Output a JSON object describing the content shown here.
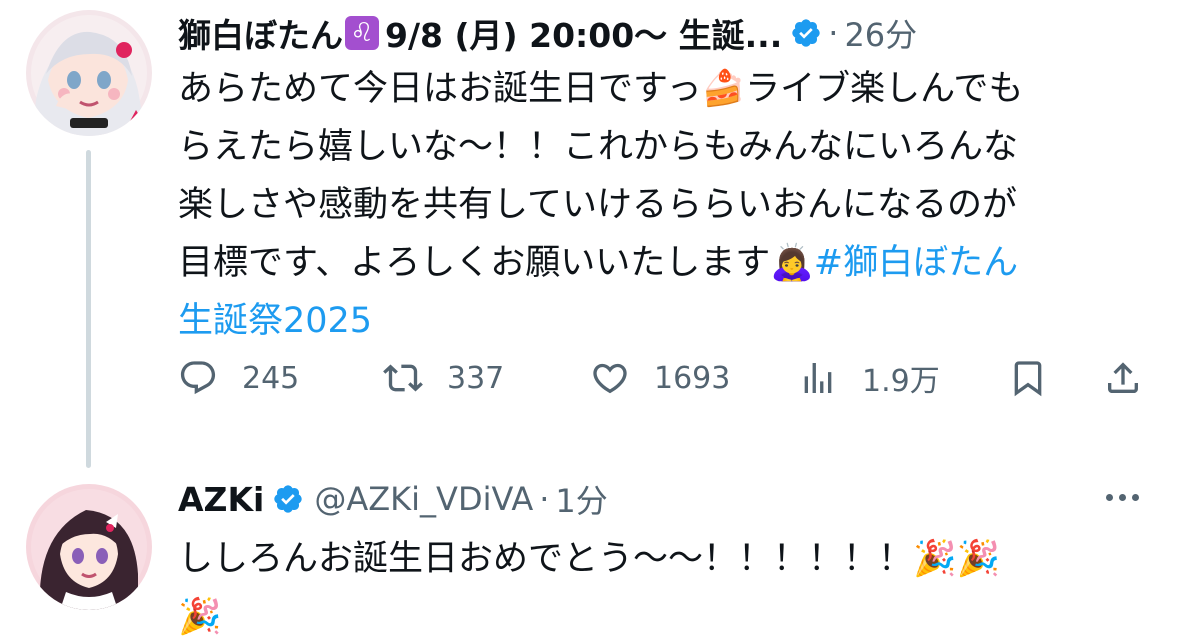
{
  "tweets": [
    {
      "display_name": "獅白ぼたん",
      "name_badge": "♌",
      "name_suffix": "9/8 (月) 20:00～ 生誕...",
      "time": "26分",
      "dot": "·",
      "body_lines": [
        "あらためて今日はお誕生日ですっ🍰ライブ楽しんでも",
        "らえたら嬉しいな～！！これからもみんなにいろんな",
        "楽しさや感動を共有していけるららいおんになるのが",
        "目標です、よろしくお願いいたします🙇‍♀️"
      ],
      "hashtag_part1": "#獅白ぼたん",
      "hashtag_part2": "生誕祭2025",
      "stats": {
        "replies": "245",
        "retweets": "337",
        "likes": "1693",
        "views": "1.9万"
      }
    },
    {
      "display_name": "AZKi",
      "handle": "@AZKi_VDiVA",
      "dot": "·",
      "time": "1分",
      "body_lines": [
        "ししろんお誕生日おめでとう～～！！！！！！🎉🎉",
        "🎉"
      ]
    }
  ],
  "colors": {
    "text": "#0f1419",
    "secondary": "#536471",
    "link": "#1d9bf0",
    "verified": "#1d9bf0",
    "thread_line": "#cfd9de",
    "leo_badge": "#a34fcf"
  },
  "icons": {
    "reply": "reply-icon",
    "retweet": "retweet-icon",
    "like": "heart-icon",
    "views": "bar-chart-icon",
    "bookmark": "bookmark-icon",
    "share": "share-icon",
    "verified": "verified-badge-icon",
    "more": "more-dots-icon"
  }
}
